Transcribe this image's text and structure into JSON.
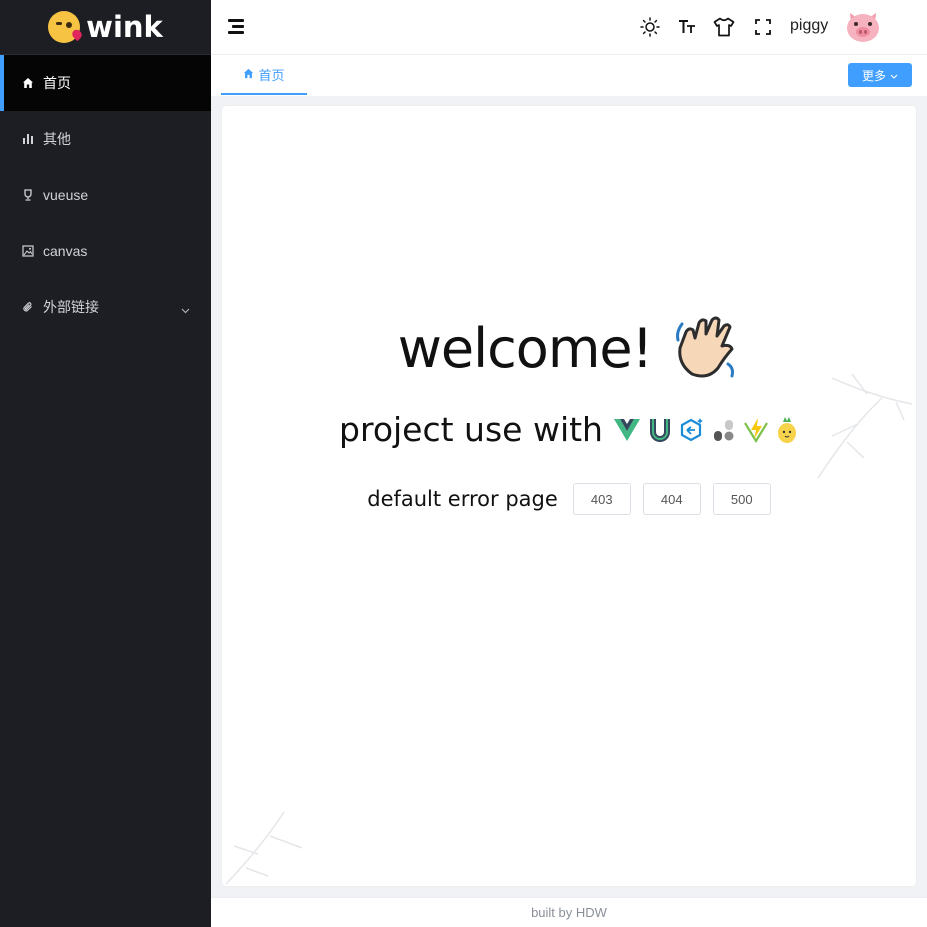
{
  "sidebar": {
    "logo_text": "wink",
    "logo_icon": "kissing-face-emoji",
    "items": [
      {
        "label": "首页",
        "icon": "home-icon",
        "active": true
      },
      {
        "label": "其他",
        "icon": "bar-chart-icon",
        "active": false
      },
      {
        "label": "vueuse",
        "icon": "trophy-icon",
        "active": false
      },
      {
        "label": "canvas",
        "icon": "image-icon",
        "active": false
      },
      {
        "label": "外部链接",
        "icon": "paperclip-icon",
        "active": false,
        "has_submenu": true
      }
    ]
  },
  "header": {
    "toggle_icon": "hamburger-icon",
    "actions": [
      "sun-icon",
      "font-size-icon",
      "tshirt-icon",
      "fullscreen-icon"
    ],
    "username": "piggy",
    "avatar": "pig-face-emoji"
  },
  "tabs": {
    "items": [
      {
        "label": "首页",
        "icon": "home-icon",
        "active": true
      }
    ],
    "more_label": "更多"
  },
  "main": {
    "welcome": "welcome!",
    "welcome_emoji": "waving-hand-emoji",
    "project_text": "project use with",
    "tech_icons": [
      "vue-icon",
      "unocss-icon",
      "esbuild-icon",
      "vueuse-icon",
      "vite-icon",
      "pinia-icon"
    ],
    "errors_label": "default error page",
    "error_buttons": [
      "403",
      "404",
      "500"
    ]
  },
  "footer": {
    "text": "built by HDW"
  },
  "colors": {
    "sidebar_bg": "#1d1e23",
    "active_item_bg": "#050506",
    "accent": "#409eff",
    "page_bg": "#f0f2f5"
  }
}
